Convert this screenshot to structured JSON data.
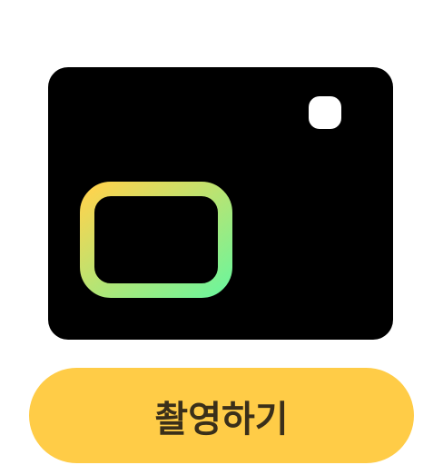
{
  "camera": {
    "icon": "camera-icon",
    "lens_icon": "lens-frame-icon",
    "flash_icon": "flash-dot-icon",
    "body_color": "#000000",
    "lens_gradient": [
      "#FFD34D",
      "#6FF59A"
    ]
  },
  "capture_button": {
    "label": "촬영하기",
    "background_color": "#FFCC47",
    "text_color": "#3A2F1A"
  }
}
